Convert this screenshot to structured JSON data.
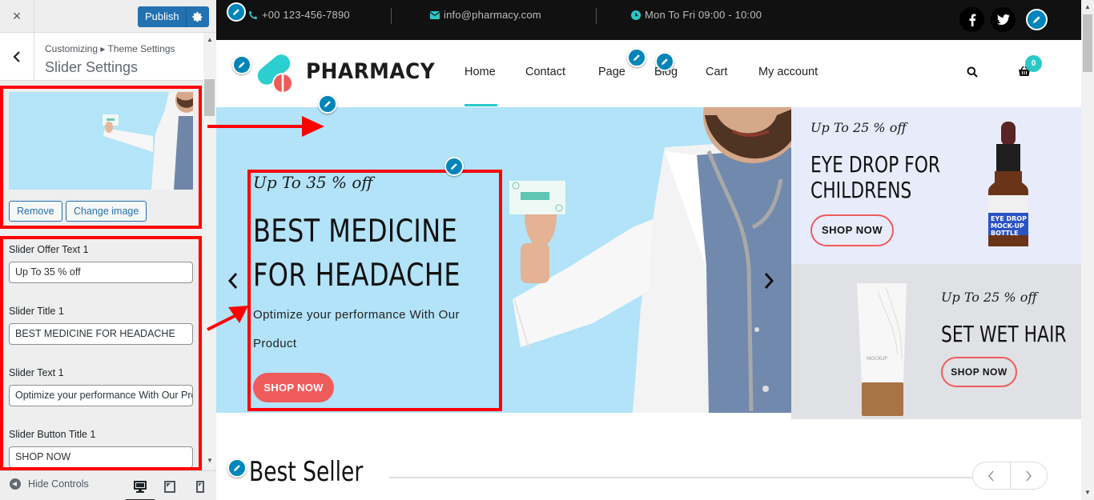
{
  "customizer": {
    "close_label": "×",
    "publish_label": "Publish",
    "breadcrumb": "Customizing ▸ Theme Settings",
    "section_title": "Slider Settings",
    "image_buttons": {
      "remove": "Remove",
      "change": "Change image"
    },
    "fields": [
      {
        "label": "Slider Offer Text 1",
        "value": "Up To 35 % off"
      },
      {
        "label": "Slider Title 1",
        "value": "BEST MEDICINE FOR  HEADACHE"
      },
      {
        "label": "Slider Text 1",
        "value": "Optimize your performance With Our Product"
      },
      {
        "label": "Slider Button Title 1",
        "value": "SHOP NOW"
      }
    ],
    "footer": {
      "hide_controls": "Hide Controls",
      "devices": [
        "desktop",
        "tablet",
        "mobile"
      ],
      "active_device": "desktop"
    }
  },
  "site": {
    "topbar": {
      "phone": "+00 123-456-7890",
      "email": "info@pharmacy.com",
      "hours": "Mon To Fri 09:00 - 10:00",
      "social": [
        "facebook",
        "twitter"
      ]
    },
    "brand": "PHARMACY",
    "nav": [
      "Home",
      "Contact",
      "Page",
      "Blog",
      "Cart",
      "My account"
    ],
    "active_nav": "Home",
    "cart_count": "0",
    "hero": {
      "offer": "Up To 35 % off",
      "title": "BEST MEDICINE FOR HEADACHE",
      "text": "Optimize your performance With Our Product",
      "button": "SHOP NOW"
    },
    "banners": [
      {
        "offer": "Up To 25 % off",
        "title_lines": [
          "EYE DROP FOR",
          "CHILDRENS"
        ],
        "button": "SHOP NOW",
        "label_lines": [
          "EYE DROP",
          "MOCK-UP",
          "BOTTLE"
        ]
      },
      {
        "offer": "Up To 25 % off",
        "title_lines": [
          "SET WET HAIR"
        ],
        "button": "SHOP NOW",
        "label": "MOCKUP"
      }
    ],
    "section_heading": "Best Seller"
  },
  "colors": {
    "accent": "#2bc8c8",
    "cta": "#ef5b5b",
    "wp_blue": "#2271b1",
    "highlight": "#ff0000"
  }
}
